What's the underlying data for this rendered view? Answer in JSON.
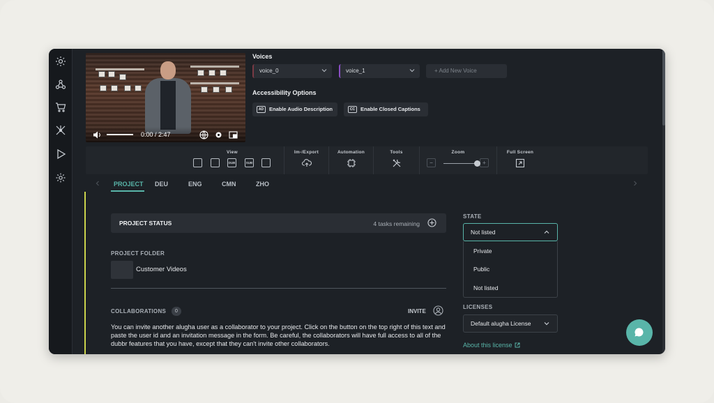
{
  "video": {
    "time": "0:00 / 2:47"
  },
  "voices": {
    "title": "Voices",
    "items": [
      "voice_0",
      "voice_1"
    ],
    "add_label": "Add New Voice"
  },
  "accessibility": {
    "title": "Accessibility Options",
    "audio_desc_badge": "AD",
    "audio_desc_label": "Enable Audio Description",
    "captions_badge": "CC",
    "captions_label": "Enable Closed Captions"
  },
  "toolbar": {
    "groups": [
      "View",
      "Im-/Export",
      "Automation",
      "Tools",
      "Zoom",
      "Full Screen"
    ],
    "view_dub": "DUB",
    "view_sub": "SUB"
  },
  "tabs": [
    "PROJECT",
    "DEU",
    "ENG",
    "CMN",
    "ZHO"
  ],
  "status": {
    "title": "PROJECT STATUS",
    "remaining": "4 tasks remaining"
  },
  "folder": {
    "label": "PROJECT FOLDER",
    "name": "Customer Videos"
  },
  "collab": {
    "label": "COLLABORATIONS",
    "count": "0",
    "invite": "INVITE",
    "text": "You can invite another alugha user as a collaborator to your project. Click on the button on the top right of this text and paste the user id and an invitation message in the form. Be careful, the collaborators will have full access to all of the dubbr features that you have, except that they can't invite other collaborators."
  },
  "state": {
    "label": "STATE",
    "selected": "Not listed",
    "options": [
      "Private",
      "Public",
      "Not listed"
    ]
  },
  "licenses": {
    "label": "LICENSES",
    "selected": "Default alugha License",
    "about": "About this license"
  },
  "colors": {
    "accent": "#59b5a9",
    "highlight": "#cbd34c",
    "background": "#1d2126"
  }
}
